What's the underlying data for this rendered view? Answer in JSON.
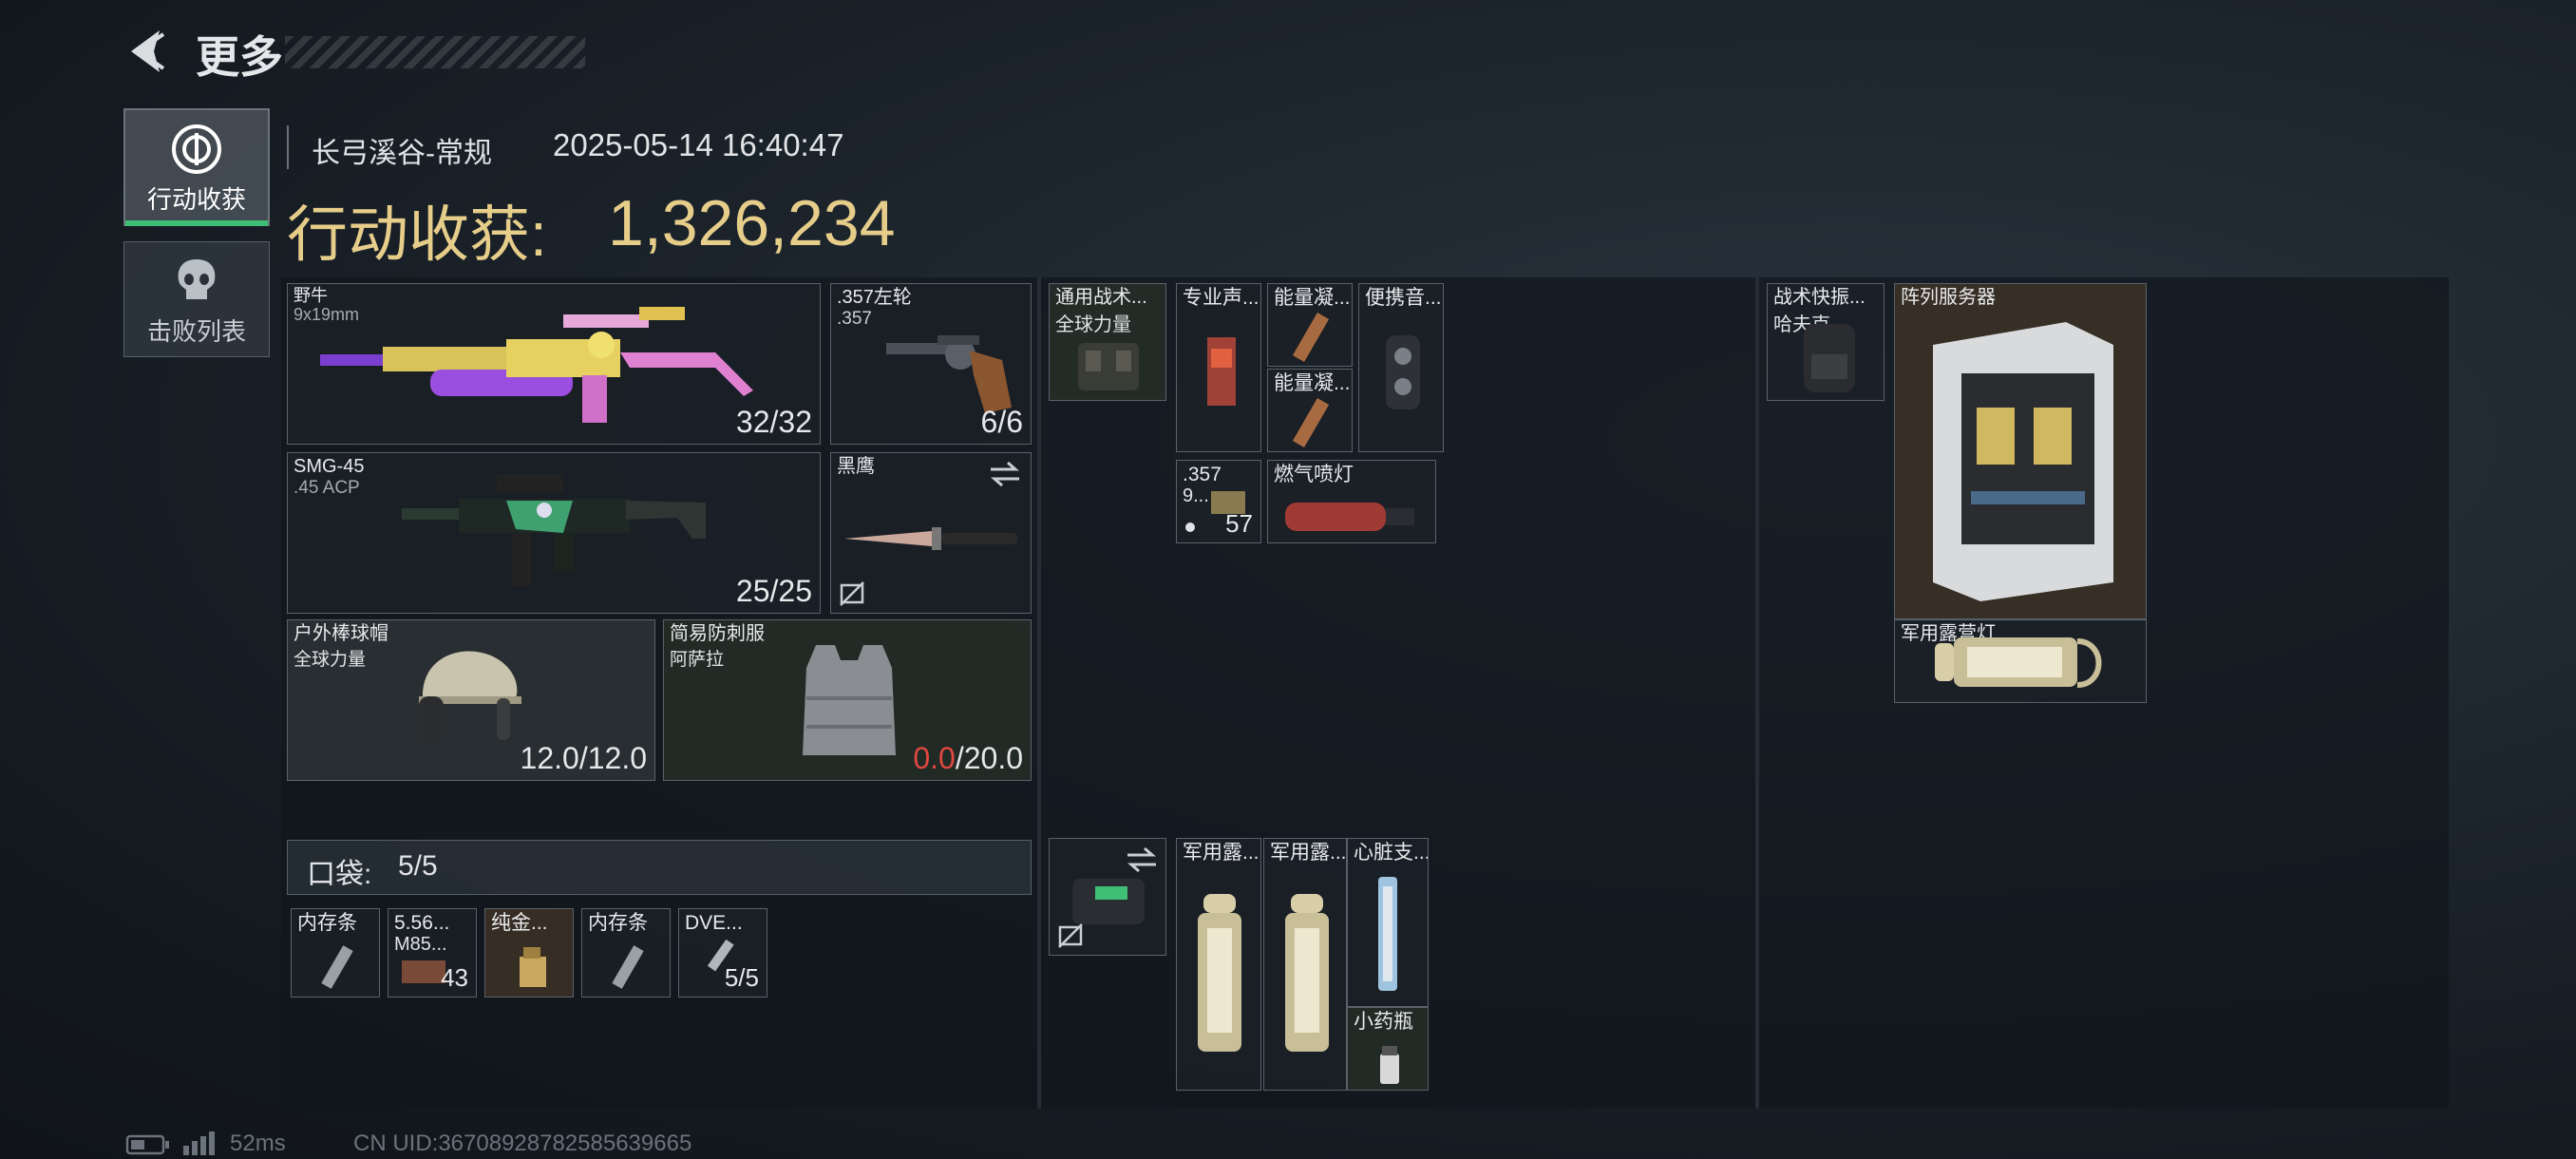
{
  "header": {
    "title": "更多"
  },
  "sidebar": {
    "tabs": [
      {
        "label": "行动收获"
      },
      {
        "label": "击败列表"
      }
    ]
  },
  "info": {
    "map": "长弓溪谷-常规",
    "datetime": "2025-05-14 16:40:47",
    "value_label": "行动收获:",
    "value": "1,326,234"
  },
  "weapons": [
    {
      "name": "野牛",
      "caliber": "9x19mm",
      "ammo": "32/32"
    },
    {
      "name": ".357左轮",
      "caliber": ".357",
      "ammo": "6/6"
    },
    {
      "name": "SMG-45",
      "caliber": ".45 ACP",
      "ammo": "25/25"
    },
    {
      "name": "黑鹰"
    }
  ],
  "armor": [
    {
      "name": "户外棒球帽",
      "maker": "全球力量",
      "dura": "12.0/12.0"
    },
    {
      "name": "简易防刺服",
      "maker": "阿萨拉",
      "dura_current": "0.0",
      "dura_max": "/20.0"
    }
  ],
  "pocket": {
    "label": "口袋:",
    "count": "5/5",
    "items": [
      {
        "name": "内存条"
      },
      {
        "name": "5.56...",
        "sub": "M85...",
        "count": "43"
      },
      {
        "name": "纯金..."
      },
      {
        "name": "内存条"
      },
      {
        "name": "DVE...",
        "count": "5/5"
      }
    ]
  },
  "rig": {
    "items": [
      {
        "name": "通用战术...",
        "sub": "全球力量"
      },
      {
        "name": "专业声..."
      },
      {
        "name": "能量凝..."
      },
      {
        "name": "便携音..."
      },
      {
        "name": "能量凝..."
      },
      {
        "name": ".357",
        "sub": "9...",
        "count": "57"
      },
      {
        "name": "燃气喷灯"
      }
    ]
  },
  "bag": {
    "items": [
      {
        "name": "军用露..."
      },
      {
        "name": "军用露..."
      },
      {
        "name": "心脏支..."
      },
      {
        "name": "小药瓶"
      }
    ]
  },
  "backpack": {
    "name": "战术快振...",
    "sub": "哈夫克",
    "items": [
      {
        "name": "阵列服务器"
      },
      {
        "name": "军用露营灯"
      }
    ]
  },
  "footer": {
    "ping": "52ms",
    "uid": "CN UID:3670892878258563966​5"
  },
  "colors": {
    "gold": "#e6cd8a",
    "red": "#e0473f",
    "accent_green": "#3fbf75"
  }
}
